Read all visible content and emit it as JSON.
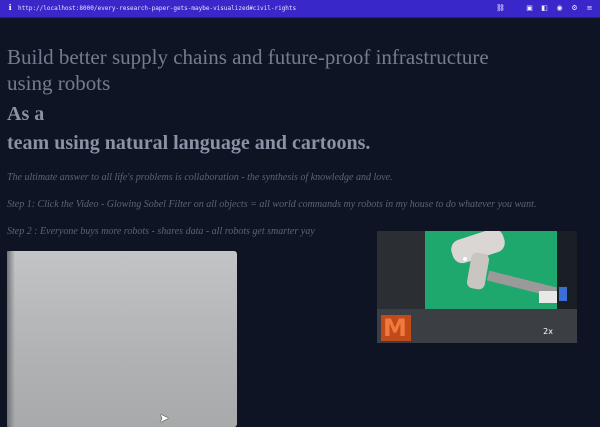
{
  "browser": {
    "url": "http://localhost:8000/every-research-paper-gets-maybe-visualized#civil-rights",
    "icons": [
      "link-icon",
      "camera-icon",
      "screenshot-icon",
      "record-icon",
      "settings-icon",
      "menu-icon"
    ]
  },
  "page": {
    "heading_line": "Build better supply chains and future-proof infrastructure using robots",
    "subheading_1": "As a",
    "subheading_2": "team using natural language and cartoons.",
    "tagline": "The ultimate answer to all life's problems is collaboration - the synthesis of knowledge and love.",
    "step1": "Step 1: Click the Video - Glowing Sobel Filter on all objects = all world commands my robots in my house to do whatever you want.",
    "step2": "Step 2 : Everyone buys more robots - shares data - all robots get smarter yay"
  },
  "videos": {
    "right": {
      "logo_text": "M",
      "speed_badge": "2x"
    }
  },
  "colors": {
    "browser_bar": "#3a27c9",
    "page_background": "#0f1424",
    "heading_text": "#747c90",
    "body_text": "#5b6378",
    "video_green": "#1ea86e"
  }
}
